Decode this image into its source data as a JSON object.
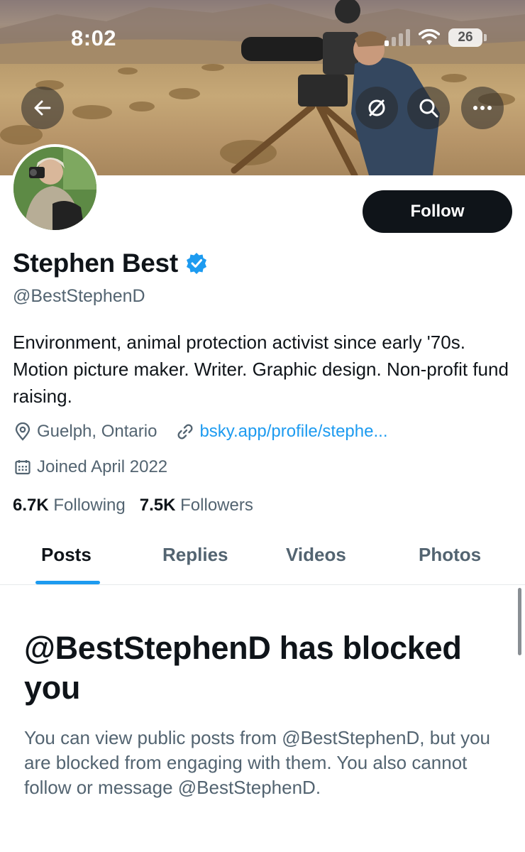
{
  "status_bar": {
    "time": "8:02",
    "battery": "26"
  },
  "profile": {
    "display_name": "Stephen Best",
    "handle": "@BestStephenD",
    "bio": "Environment, animal protection activist since early '70s. Motion picture maker. Writer. Graphic design. Non-profit fund raising.",
    "location": "Guelph, Ontario",
    "website": "bsky.app/profile/stephe...",
    "joined": "Joined April 2022",
    "following_count": "6.7K",
    "following_label": "Following",
    "followers_count": "7.5K",
    "followers_label": "Followers"
  },
  "actions": {
    "follow_label": "Follow"
  },
  "tabs": [
    {
      "label": "Posts"
    },
    {
      "label": "Replies"
    },
    {
      "label": "Videos"
    },
    {
      "label": "Photos"
    }
  ],
  "blocked": {
    "title": "@BestStephenD has blocked you",
    "message": "You can view public posts from @BestStephenD, but you are blocked from engaging with them. You also cannot follow or message @BestStephenD."
  },
  "icons": {
    "back": "arrow-left-icon",
    "notifications_off": "bell-off-icon",
    "search": "search-icon",
    "more": "more-horizontal-icon",
    "verified": "verified-badge-icon",
    "location": "map-pin-icon",
    "link": "link-icon",
    "calendar": "calendar-icon"
  },
  "colors": {
    "accent": "#1d9bf0",
    "text_primary": "#0f1419",
    "text_secondary": "#536471",
    "follow_button": "#0f1419"
  }
}
